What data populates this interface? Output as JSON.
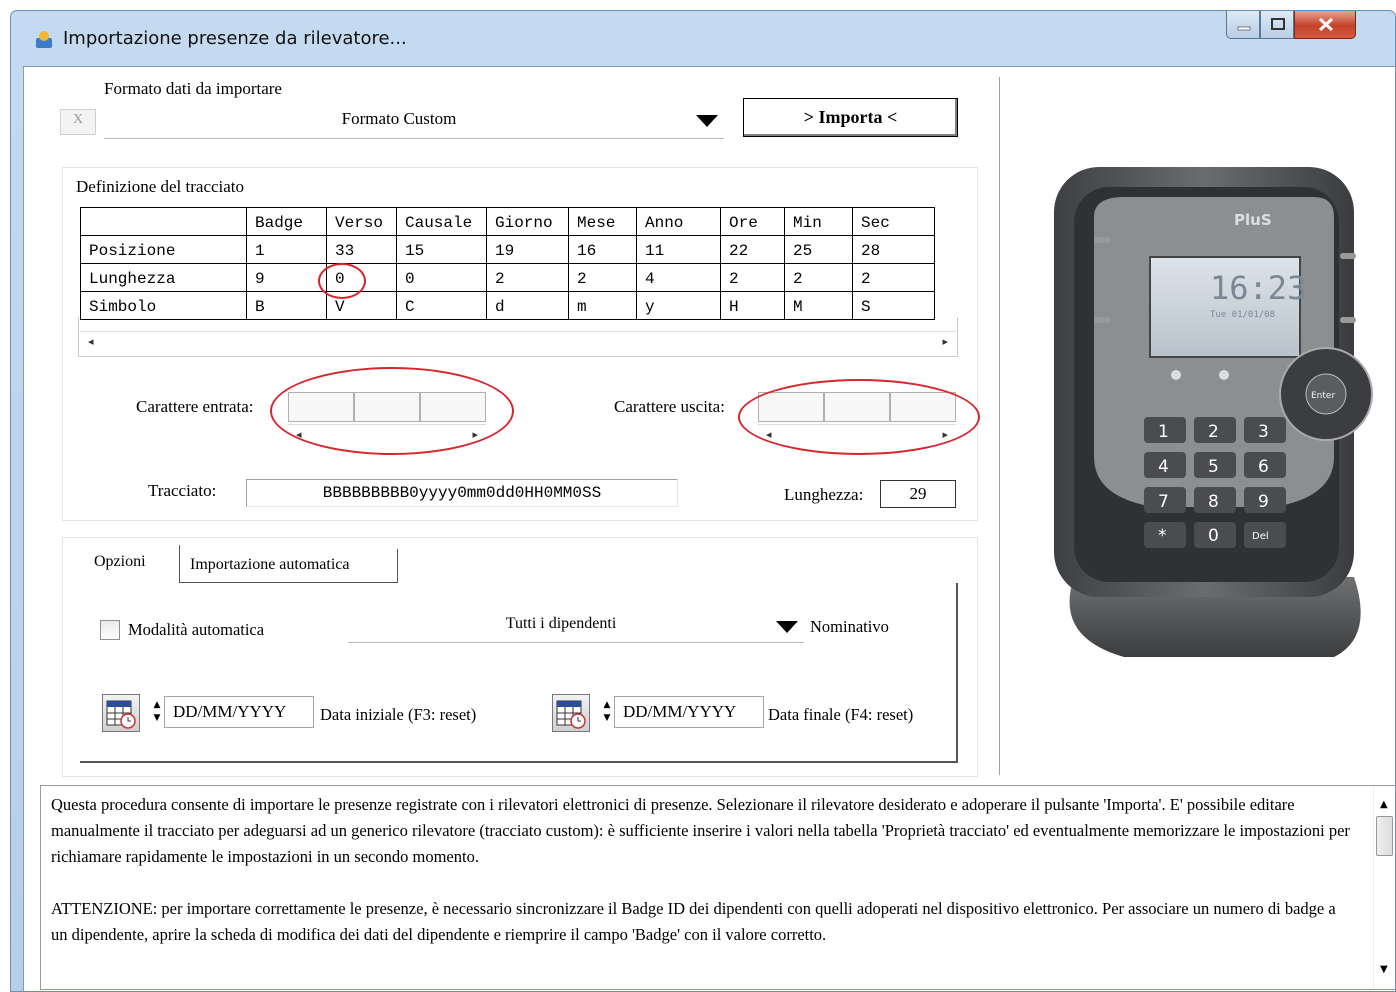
{
  "window": {
    "title": "Importazione presenze da rilevatore...",
    "accent": "#c4daf0",
    "close_color": "#c4432b"
  },
  "format": {
    "label": "Formato dati da importare",
    "clear_button": "X",
    "selected": "Formato Custom",
    "import_button": "> Importa <"
  },
  "tracciato": {
    "group_label": "Definizione del tracciato",
    "columns": [
      "",
      "Badge",
      "Verso",
      "Causale",
      "Giorno",
      "Mese",
      "Anno",
      "Ore",
      "Min",
      "Sec"
    ],
    "rows": [
      {
        "name": "Posizione",
        "cells": [
          "1",
          "33",
          "15",
          "19",
          "16",
          "11",
          "22",
          "25",
          "28"
        ]
      },
      {
        "name": "Lunghezza",
        "cells": [
          "9",
          "0",
          "0",
          "2",
          "2",
          "4",
          "2",
          "2",
          "2"
        ]
      },
      {
        "name": "Simbolo",
        "cells": [
          "B",
          "V",
          "C",
          "d",
          "m",
          "y",
          "H",
          "M",
          "S"
        ]
      }
    ],
    "scroll_left": "◂",
    "scroll_right": "▸",
    "char_in_label": "Carattere entrata:",
    "char_out_label": "Carattere uscita:",
    "tracciato_label": "Tracciato:",
    "tracciato_value": "BBBBBBBBB0yyyy0mm0dd0HH0MM0SS",
    "lunghezza_label": "Lunghezza:",
    "lunghezza_value": "29",
    "highlight_color": "#d4282e"
  },
  "tabs": [
    {
      "label": "Opzioni"
    },
    {
      "label": "Importazione automatica"
    }
  ],
  "options": {
    "auto_mode_label": "Modalità automatica",
    "auto_mode_checked": false,
    "employees_selected": "Tutti i dipendenti",
    "nominativo_label": "Nominativo",
    "date_start_placeholder": "DD/MM/YYYY",
    "date_start_label": "Data iniziale (F3: reset)",
    "date_end_placeholder": "DD/MM/YYYY",
    "date_end_label": "Data finale (F4: reset)"
  },
  "device": {
    "brand": "PluS",
    "time": "16:23",
    "date_line": "Tue 01/01/08",
    "enter_key": "Enter",
    "keys": [
      "1",
      "2",
      "3",
      "4",
      "5",
      "6",
      "7",
      "8",
      "9",
      "*",
      "0",
      "Del"
    ]
  },
  "description": {
    "paragraph1": "Questa procedura consente di importare le presenze registrate con i rilevatori elettronici di presenze. Selezionare il rilevatore  desiderato e adoperare il pulsante 'Importa'. E' possibile editare manualmente il tracciato per adeguarsi ad un generico rilevatore (tracciato custom): è sufficiente inserire i valori nella tabella 'Proprietà tracciato' ed eventualmente memorizzare le impostazioni per richiamare rapidamente le impostazioni in un secondo momento.",
    "paragraph2": "ATTENZIONE: per importare correttamente le presenze, è necessario sincronizzare il Badge ID dei dipendenti con quelli adoperati nel dispositivo elettronico. Per associare un numero di badge a un dipendente, aprire la scheda di modifica dei dati del dipendente e riemprire il campo 'Badge' con il valore corretto."
  }
}
